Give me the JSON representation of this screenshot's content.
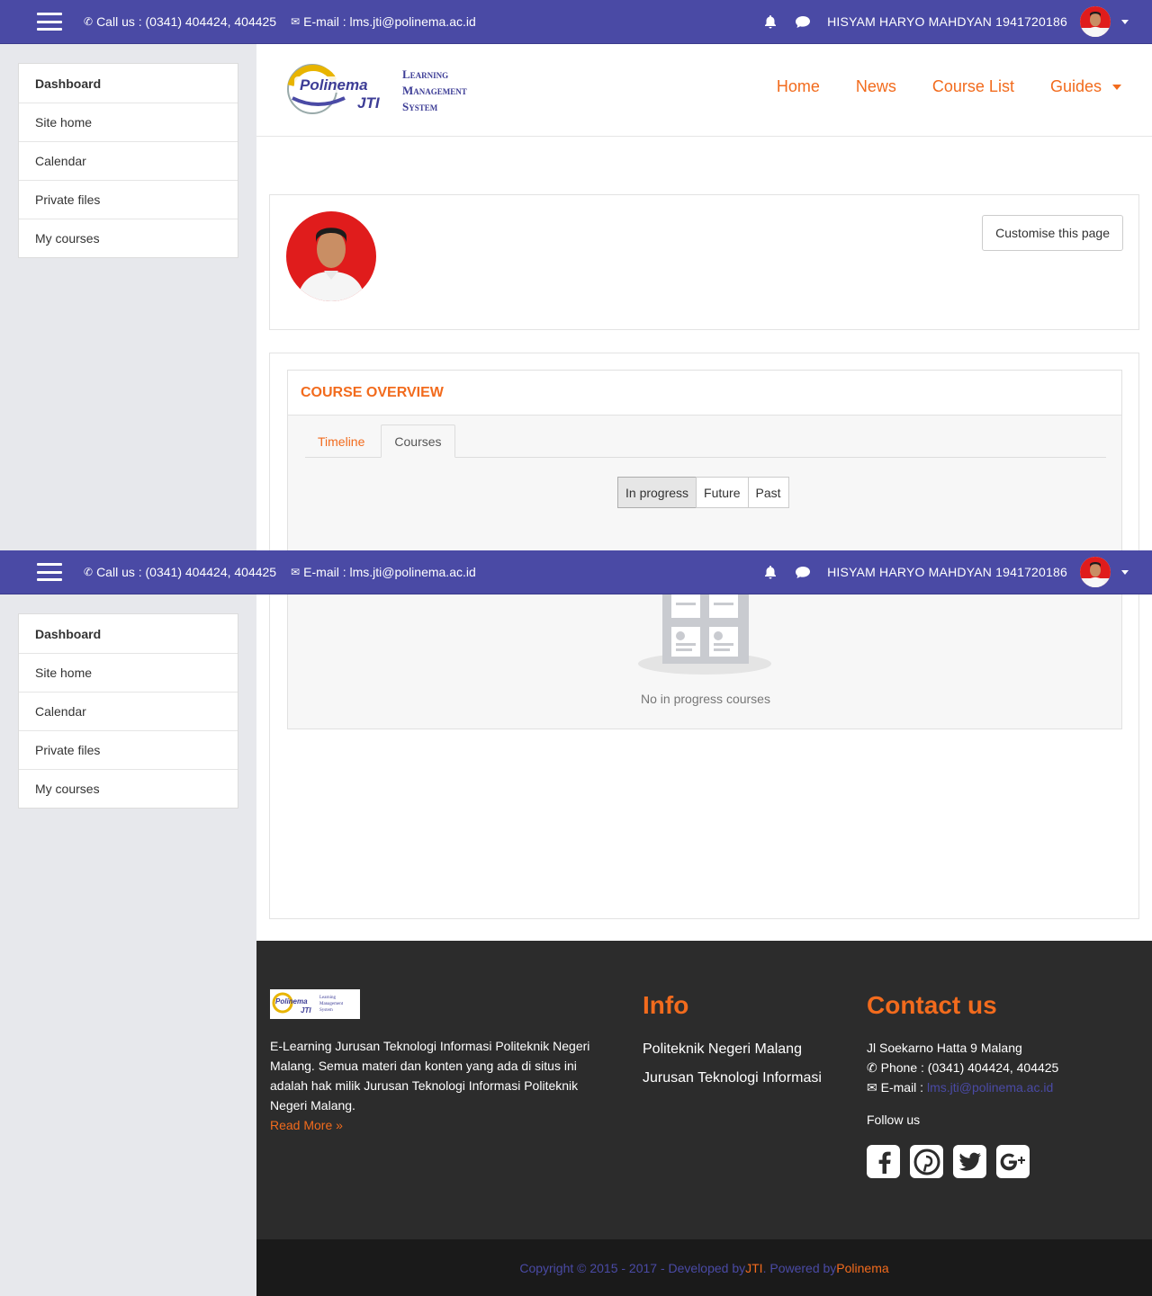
{
  "topbar": {
    "call_label": "Call us : (0341) 404424, 404425",
    "email_label": "E-mail : lms.jti@polinema.ac.id",
    "username": "HISYAM HARYO MAHDYAN 1941720186"
  },
  "sidebar": {
    "items": [
      {
        "label": "Dashboard"
      },
      {
        "label": "Site home"
      },
      {
        "label": "Calendar"
      },
      {
        "label": "Private files"
      },
      {
        "label": "My courses"
      }
    ]
  },
  "brand": {
    "logo_word": "Polinema",
    "logo_sub": "JTI",
    "logo_line1": "Learning",
    "logo_line2": "Management",
    "logo_line3": "System"
  },
  "mainnav": {
    "home": "Home",
    "news": "News",
    "course_list": "Course List",
    "guides": "Guides"
  },
  "profile": {
    "customise_label": "Customise this page"
  },
  "course_overview": {
    "title": "COURSE OVERVIEW",
    "tabs": [
      {
        "label": "Timeline"
      },
      {
        "label": "Courses"
      }
    ],
    "filters": [
      {
        "label": "In progress"
      },
      {
        "label": "Future"
      },
      {
        "label": "Past"
      }
    ],
    "empty_text": "No in progress courses"
  },
  "footer": {
    "description": "E-Learning Jurusan Teknologi Informasi Politeknik Negeri Malang. Semua materi dan konten yang ada di situs ini adalah hak milik Jurusan Teknologi Informasi Politeknik Negeri Malang.",
    "read_more": "Read More »",
    "info_title": "Info",
    "info_links": [
      {
        "label": "Politeknik Negeri Malang"
      },
      {
        "label": "Jurusan Teknologi Informasi"
      }
    ],
    "contact_title": "Contact us",
    "address": "Jl Soekarno Hatta 9 Malang",
    "phone": "Phone : (0341) 404424, 404425",
    "email_prefix": "E-mail : ",
    "email": "lms.jti@polinema.ac.id",
    "follow": "Follow us"
  },
  "copyright": {
    "prefix": "Copyright © 2015 - 2017 - Developed by ",
    "jti": "JTI",
    "mid": ". Powered by ",
    "polinema": "Polinema"
  },
  "colors": {
    "topbar": "#4a4aa5",
    "accent": "#f26b1d",
    "sidebar_bg": "#e7e8ec",
    "footer_bg": "#2c2c2c"
  }
}
